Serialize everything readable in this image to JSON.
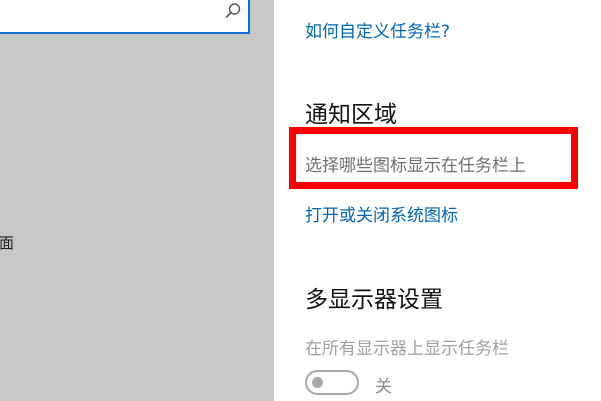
{
  "sidebar": {
    "search": {
      "value": "",
      "placeholder": ""
    },
    "partial_item_label": "面"
  },
  "main": {
    "customize_taskbar_link": "如何自定义任务栏?",
    "notification_area": {
      "heading": "通知区域",
      "select_icons_link": "选择哪些图标显示在任务栏上",
      "system_icons_link": "打开或关闭系统图标"
    },
    "multi_display": {
      "heading": "多显示器设置",
      "show_on_all_label": "在所有显示器上显示任务栏",
      "toggle_state_label": "关",
      "toggle_on": false
    }
  },
  "colors": {
    "accent": "#0066b4",
    "highlight": "#ff0000",
    "sidebar_bg": "#c8c8c8"
  }
}
